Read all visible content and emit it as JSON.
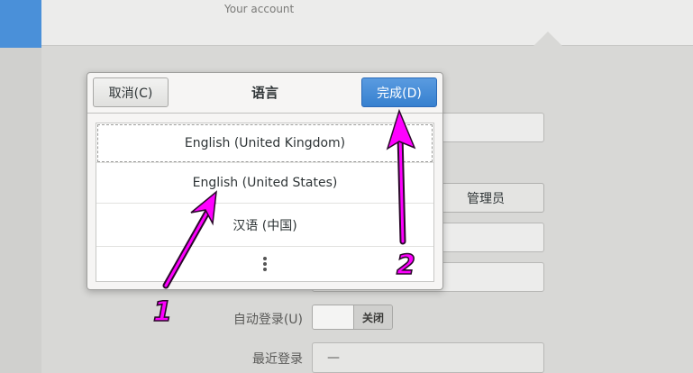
{
  "header": {
    "subtitle": "Your account"
  },
  "background_form": {
    "account_type_button": "管理员",
    "auto_login_label": "自动登录(U)",
    "auto_login_toggle": "关闭",
    "last_login_label": "最近登录",
    "last_login_value": "—"
  },
  "dialog": {
    "title": "语言",
    "cancel_label": "取消(C)",
    "done_label": "完成(D)",
    "languages": [
      {
        "label": "English (United Kingdom)"
      },
      {
        "label": "English (United States)"
      },
      {
        "label": "汉语 (中国)"
      }
    ],
    "more_icon": "vertical-ellipsis-icon"
  },
  "annotations": {
    "arrow_color": "#ff00ff",
    "labels": [
      "1",
      "2"
    ]
  },
  "colors": {
    "accent": "#3a86d4",
    "selected_sidebar": "#4a90d9"
  }
}
